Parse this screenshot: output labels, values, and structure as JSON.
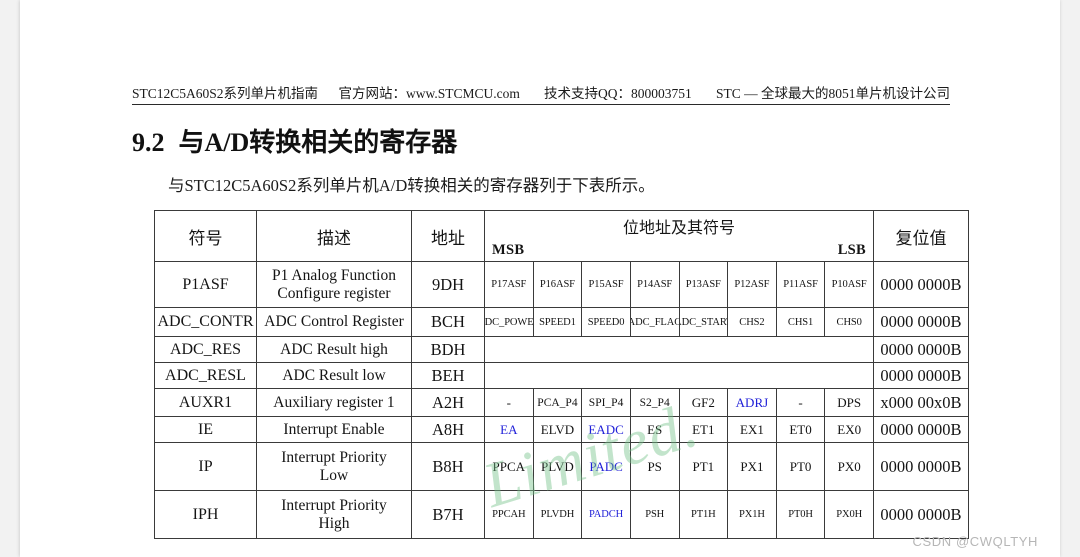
{
  "doc_header": {
    "manual": "STC12C5A60S2系列单片机指南",
    "website": "官方网站：www.STCMCU.com",
    "support": "技术支持QQ：800003751",
    "company": "STC — 全球最大的8051单片机设计公司"
  },
  "section": {
    "number": "9.2",
    "title": "与A/D转换相关的寄存器"
  },
  "intro": "与STC12C5A60S2系列单片机A/D转换相关的寄存器列于下表所示。",
  "table": {
    "headers": {
      "symbol": "符号",
      "description": "描述",
      "address": "地址",
      "bits": "位地址及其符号",
      "msb": "MSB",
      "lsb": "LSB",
      "reset": "复位值"
    },
    "rows": [
      {
        "symbol": "P1ASF",
        "description": "P1 Analog Function Configure register",
        "description_line1": "P1 Analog Function",
        "description_line2": "Configure register",
        "address": "9DH",
        "bits": [
          {
            "label": "P17ASF",
            "blue": false
          },
          {
            "label": "P16ASF",
            "blue": false
          },
          {
            "label": "P15ASF",
            "blue": false
          },
          {
            "label": "P14ASF",
            "blue": false
          },
          {
            "label": "P13ASF",
            "blue": false
          },
          {
            "label": "P12ASF",
            "blue": false
          },
          {
            "label": "P11ASF",
            "blue": false
          },
          {
            "label": "P10ASF",
            "blue": false
          }
        ],
        "reset": "0000 0000B"
      },
      {
        "symbol": "ADC_CONTR",
        "description": "ADC Control Register",
        "description_line1": "ADC Control Register",
        "description_line2": "",
        "address": "BCH",
        "bits": [
          {
            "label": "ADC_POWER",
            "blue": false
          },
          {
            "label": "SPEED1",
            "blue": false
          },
          {
            "label": "SPEED0",
            "blue": false
          },
          {
            "label": "ADC_FLAG",
            "blue": false
          },
          {
            "label": "ADC_START",
            "blue": false
          },
          {
            "label": "CHS2",
            "blue": false
          },
          {
            "label": "CHS1",
            "blue": false
          },
          {
            "label": "CHS0",
            "blue": false
          }
        ],
        "reset": "0000 0000B"
      },
      {
        "symbol": "ADC_RES",
        "description": "ADC Result high",
        "description_line1": "ADC Result high",
        "description_line2": "",
        "address": "BDH",
        "bits": [],
        "reset": "0000 0000B"
      },
      {
        "symbol": "ADC_RESL",
        "description": "ADC Result low",
        "description_line1": "ADC Result low",
        "description_line2": "",
        "address": "BEH",
        "bits": [],
        "reset": "0000 0000B"
      },
      {
        "symbol": "AUXR1",
        "description": "Auxiliary register 1",
        "description_line1": "Auxiliary register 1",
        "description_line2": "",
        "address": "A2H",
        "bits": [
          {
            "label": "-",
            "blue": false
          },
          {
            "label": "PCA_P4",
            "blue": false
          },
          {
            "label": "SPI_P4",
            "blue": false
          },
          {
            "label": "S2_P4",
            "blue": false
          },
          {
            "label": "GF2",
            "blue": false
          },
          {
            "label": "ADRJ",
            "blue": true
          },
          {
            "label": "-",
            "blue": false
          },
          {
            "label": "DPS",
            "blue": false
          }
        ],
        "reset": "x000 00x0B"
      },
      {
        "symbol": "IE",
        "description": "Interrupt Enable",
        "description_line1": "Interrupt Enable",
        "description_line2": "",
        "address": "A8H",
        "bits": [
          {
            "label": "EA",
            "blue": true
          },
          {
            "label": "ELVD",
            "blue": false
          },
          {
            "label": "EADC",
            "blue": true
          },
          {
            "label": "ES",
            "blue": false
          },
          {
            "label": "ET1",
            "blue": false
          },
          {
            "label": "EX1",
            "blue": false
          },
          {
            "label": "ET0",
            "blue": false
          },
          {
            "label": "EX0",
            "blue": false
          }
        ],
        "reset": "0000 0000B"
      },
      {
        "symbol": "IP",
        "description": "Interrupt Priority Low",
        "description_line1": "Interrupt Priority",
        "description_line2": "Low",
        "address": "B8H",
        "bits": [
          {
            "label": "PPCA",
            "blue": false
          },
          {
            "label": "PLVD",
            "blue": false
          },
          {
            "label": "PADC",
            "blue": true
          },
          {
            "label": "PS",
            "blue": false
          },
          {
            "label": "PT1",
            "blue": false
          },
          {
            "label": "PX1",
            "blue": false
          },
          {
            "label": "PT0",
            "blue": false
          },
          {
            "label": "PX0",
            "blue": false
          }
        ],
        "reset": "0000 0000B"
      },
      {
        "symbol": "IPH",
        "description": "Interrupt Priority High",
        "description_line1": "Interrupt Priority",
        "description_line2": "High",
        "address": "B7H",
        "bits": [
          {
            "label": "PPCAH",
            "blue": false
          },
          {
            "label": "PLVDH",
            "blue": false
          },
          {
            "label": "PADCH",
            "blue": true
          },
          {
            "label": "PSH",
            "blue": false
          },
          {
            "label": "PT1H",
            "blue": false
          },
          {
            "label": "PX1H",
            "blue": false
          },
          {
            "label": "PT0H",
            "blue": false
          },
          {
            "label": "PX0H",
            "blue": false
          }
        ],
        "reset": "0000 0000B"
      }
    ]
  },
  "watermarks": {
    "diagonal": "Limited.",
    "csdn": "CSDN @CWQLTYH"
  },
  "colors": {
    "blue_bit": "#2020d8",
    "watermark_green": "#78c48c",
    "page_background": "#ffffff",
    "canvas_background": "#f2f2f2"
  }
}
